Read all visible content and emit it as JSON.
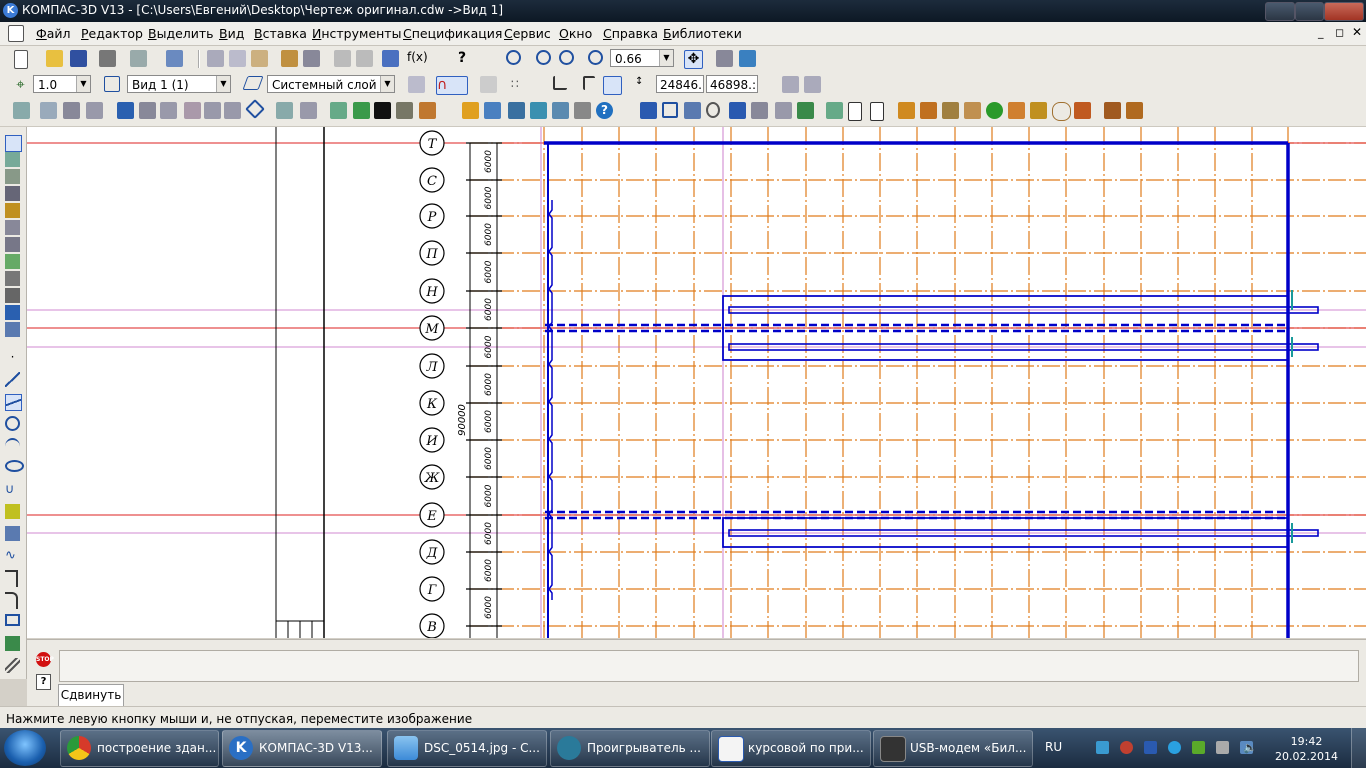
{
  "window": {
    "title": "КОМПАС-3D V13 - [C:\\Users\\Евгений\\Desktop\\Чертеж оригинал.cdw ->Вид 1]",
    "app_icon": "kompas-logo-icon"
  },
  "menu": [
    "Файл",
    "Редактор",
    "Выделить",
    "Вид",
    "Вставка",
    "Инструменты",
    "Спецификация",
    "Сервис",
    "Окно",
    "Справка",
    "Библиотеки"
  ],
  "toolbar1": {
    "zoom_value": "0.66"
  },
  "toolbar2": {
    "step_value": "1.0",
    "view_value": "Вид 1 (1)",
    "layer_value": "Системный слой (",
    "coord_x": "24846.",
    "coord_y": "46898.:"
  },
  "drawing": {
    "axis_labels": [
      "Т",
      "С",
      "Р",
      "П",
      "Н",
      "М",
      "Л",
      "К",
      "И",
      "Ж",
      "Е",
      "Д",
      "Г",
      "В"
    ],
    "dim_label": "6000",
    "total_dim": "90000",
    "colors": {
      "grid": "#e07c1c",
      "wall": "#0000c8",
      "red": "#d22",
      "pink": "#c060c0"
    }
  },
  "command": {
    "input_value": "",
    "tab_label": "Сдвинуть",
    "stop_icon": "STOP"
  },
  "status_text": "Нажмите левую кнопку мыши и, не отпуская, переместите изображение",
  "taskbar": {
    "tasks": [
      {
        "label": "построение здан...",
        "icon": "chrome-icon",
        "color": "#e8a020"
      },
      {
        "label": "КОМПАС-3D V13...",
        "icon": "kompas-icon",
        "color": "#2a6fc4",
        "active": true
      },
      {
        "label": "DSC_0514.jpg - С...",
        "icon": "image-viewer-icon",
        "color": "#3c8ad8"
      },
      {
        "label": "Проигрыватель ...",
        "icon": "media-player-icon",
        "color": "#2a7a9a"
      },
      {
        "label": "курсовой по при...",
        "icon": "word-icon",
        "color": "#2a5ab0"
      },
      {
        "label": "USB-модем «Бил...",
        "icon": "modem-icon",
        "color": "#333333"
      }
    ],
    "lang": "RU",
    "time": "19:42",
    "date": "20.02.2014"
  }
}
